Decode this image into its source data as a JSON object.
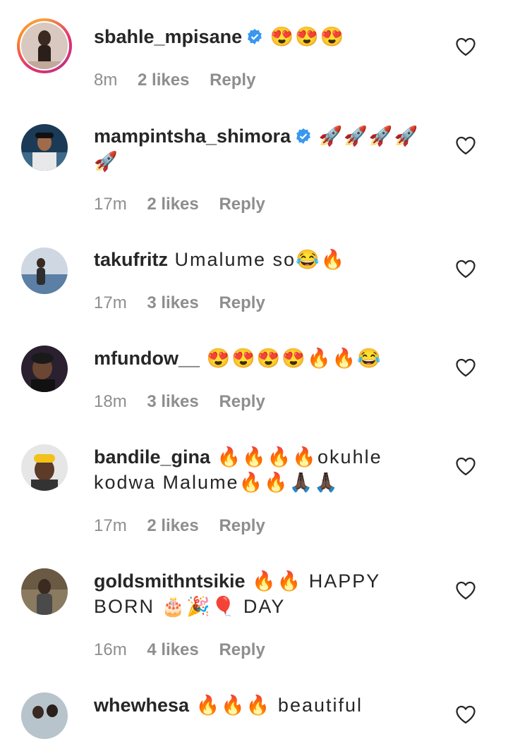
{
  "comments": [
    {
      "username": "sbahle_mpisane",
      "verified": true,
      "text": "😍😍😍",
      "time": "8m",
      "likes": "2 likes",
      "reply": "Reply",
      "avatar": "person-avatar",
      "story_ring": true
    },
    {
      "username": "mampintsha_shimora",
      "verified": true,
      "text": "🚀🚀🚀🚀🚀",
      "time": "17m",
      "likes": "2 likes",
      "reply": "Reply",
      "avatar": "person-avatar"
    },
    {
      "username": "takufritz",
      "verified": false,
      "text": "Umalume so😂🔥",
      "time": "17m",
      "likes": "3 likes",
      "reply": "Reply",
      "avatar": "person-avatar"
    },
    {
      "username": "mfundow__",
      "verified": false,
      "text": "😍😍😍😍🔥🔥😂",
      "time": "18m",
      "likes": "3 likes",
      "reply": "Reply",
      "avatar": "person-avatar"
    },
    {
      "username": "bandile_gina",
      "verified": false,
      "text": "🔥🔥🔥🔥okuhle kodwa Malume🔥🔥🙏🏿🙏🏿",
      "time": "17m",
      "likes": "2 likes",
      "reply": "Reply",
      "avatar": "person-avatar"
    },
    {
      "username": "goldsmithntsikie",
      "verified": false,
      "text": "🔥🔥 HAPPY BORN 🎂🎉🎈 DAY",
      "time": "16m",
      "likes": "4 likes",
      "reply": "Reply",
      "avatar": "person-avatar"
    },
    {
      "username": "whewhesa",
      "verified": false,
      "text": "🔥🔥🔥 beautiful",
      "avatar": "person-avatar"
    }
  ],
  "colors": {
    "text": "#262626",
    "meta": "#8e8e8e",
    "verified": "#3897f0"
  }
}
